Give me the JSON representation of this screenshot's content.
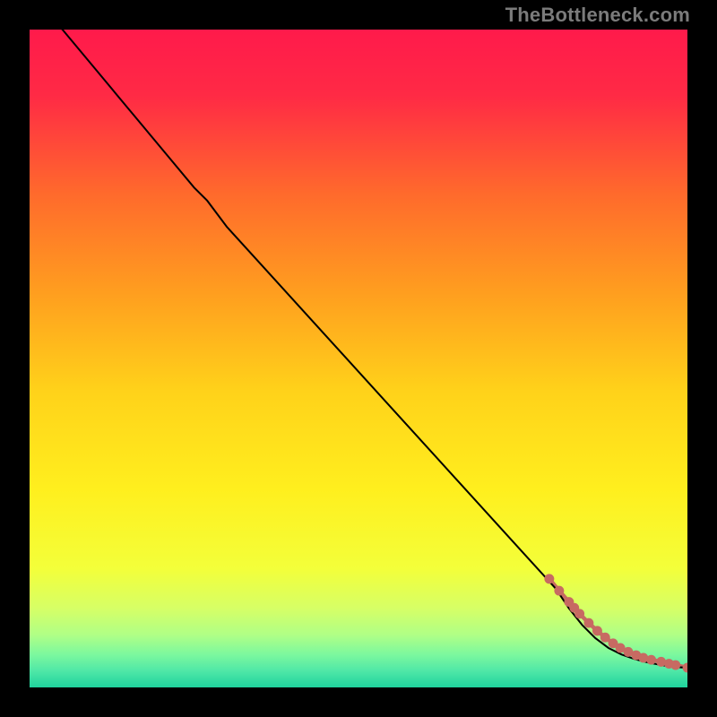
{
  "watermark": "TheBottleneck.com",
  "chart_data": {
    "type": "line",
    "title": "",
    "xlabel": "",
    "ylabel": "",
    "xlim": [
      0,
      100
    ],
    "ylim": [
      0,
      100
    ],
    "grid": false,
    "legend": false,
    "gradient_stops": [
      {
        "offset": 0.0,
        "color": "#ff1a4b"
      },
      {
        "offset": 0.1,
        "color": "#ff2a45"
      },
      {
        "offset": 0.25,
        "color": "#ff6a2c"
      },
      {
        "offset": 0.4,
        "color": "#ff9e1f"
      },
      {
        "offset": 0.55,
        "color": "#ffd21a"
      },
      {
        "offset": 0.7,
        "color": "#ffef1e"
      },
      {
        "offset": 0.82,
        "color": "#f3ff3a"
      },
      {
        "offset": 0.88,
        "color": "#d6ff66"
      },
      {
        "offset": 0.92,
        "color": "#b0ff86"
      },
      {
        "offset": 0.95,
        "color": "#7cf89e"
      },
      {
        "offset": 0.975,
        "color": "#4fe7a7"
      },
      {
        "offset": 1.0,
        "color": "#1fd39d"
      }
    ],
    "series": [
      {
        "name": "curve",
        "stroke": "#000000",
        "stroke_width": 2,
        "x": [
          0,
          5,
          10,
          15,
          20,
          25,
          27,
          30,
          35,
          40,
          45,
          50,
          55,
          60,
          65,
          70,
          75,
          80,
          82,
          84,
          86,
          88,
          90,
          92,
          94,
          96,
          98,
          100
        ],
        "y": [
          105,
          100,
          94,
          88,
          82,
          76,
          74,
          70,
          64.5,
          59,
          53.5,
          48,
          42.5,
          37,
          31.5,
          26,
          20.5,
          15,
          12,
          9.5,
          7.5,
          6,
          5,
          4.3,
          3.8,
          3.4,
          3.1,
          3
        ]
      }
    ],
    "marker_points": {
      "name": "bottleneck-band",
      "color": "#c76a62",
      "radius": 5.5,
      "line_width": 4.5,
      "x": [
        79,
        80.5,
        82,
        82.8,
        83.6,
        85,
        86.3,
        87.5,
        88.7,
        89.8,
        91,
        92.2,
        93.3,
        94.5,
        96,
        97.2,
        98.2,
        100
      ],
      "y": [
        16.5,
        14.7,
        13,
        12.1,
        11.2,
        9.8,
        8.6,
        7.6,
        6.7,
        6.0,
        5.4,
        4.9,
        4.5,
        4.2,
        3.9,
        3.6,
        3.4,
        3.0
      ]
    }
  }
}
